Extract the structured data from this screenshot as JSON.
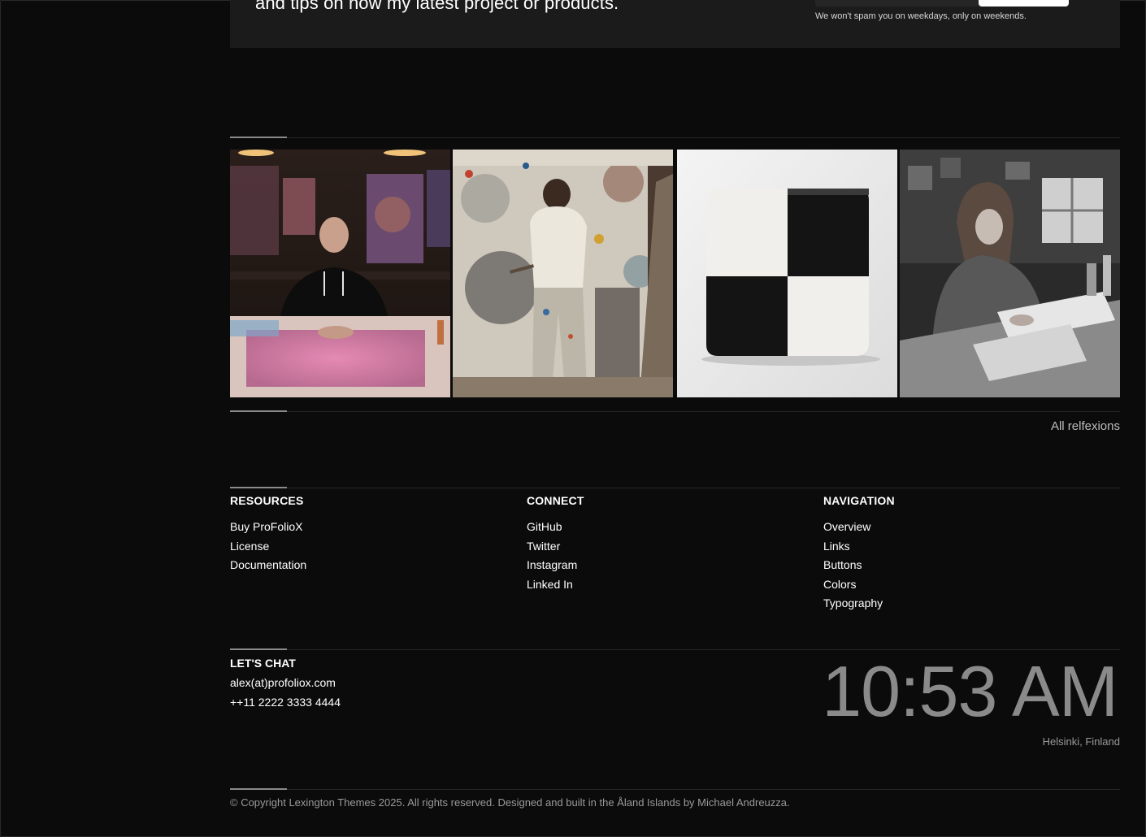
{
  "newsletter": {
    "heading": "and tips on how my latest project or products.",
    "note": "We won't spam you on weekdays, only on weekends."
  },
  "gallery": {
    "images": [
      {
        "alt": "Tattooed man in black hoodie seated at a table with a pink painting in an art studio"
      },
      {
        "alt": "Artist in paint-splattered clothes painting a large abstract mural"
      },
      {
        "alt": "Black and white checkered ceramic block on a white background"
      },
      {
        "alt": "Woman sketching at a desk in a black and white studio photo"
      }
    ],
    "all_link": "All relfexions"
  },
  "footer": {
    "resources": {
      "title": "RESOURCES",
      "items": [
        "Buy ProFolioX",
        "License",
        "Documentation"
      ]
    },
    "connect": {
      "title": "CONNECT",
      "items": [
        "GitHub",
        "Twitter",
        "Instagram",
        "Linked In"
      ]
    },
    "navigation": {
      "title": "NAVIGATION",
      "items": [
        "Overview",
        "Links",
        "Buttons",
        "Colors",
        "Typography"
      ]
    },
    "chat": {
      "title": "LET'S CHAT",
      "email": "alex(at)profoliox.com",
      "phone": "++11 2222 3333 4444"
    },
    "clock": {
      "time": "10:53 AM",
      "location": "Helsinki, Finland"
    },
    "copyright": "© Copyright Lexington Themes 2025. All rights reserved. Designed and built in the Åland Islands by Michael Andreuzza."
  }
}
